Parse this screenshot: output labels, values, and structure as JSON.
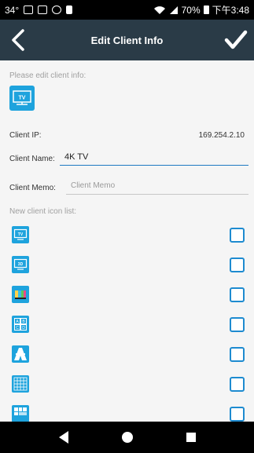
{
  "status_bar": {
    "temperature": "34°",
    "battery": "70%",
    "time": "下午3:48"
  },
  "app_bar": {
    "title": "Edit Client Info",
    "back_icon": "chevron-left-icon",
    "done_icon": "checkmark-icon"
  },
  "form": {
    "prompt": "Please edit client info:",
    "client_icon_text": "TV",
    "ip_label": "Client IP:",
    "ip_value": "169.254.2.10",
    "name_label": "Client Name:",
    "name_value": "4K TV",
    "memo_label": "Client Memo:",
    "memo_placeholder": "Client Memo",
    "list_heading": "New client icon list:"
  },
  "icon_list": [
    {
      "icon": "tv-icon",
      "label": "TV",
      "checked": false
    },
    {
      "icon": "3d-tv-icon",
      "label": "3D",
      "checked": false
    },
    {
      "icon": "color-bars-icon",
      "checked": false
    },
    {
      "icon": "abcd-grid-icon",
      "label": "A B C D",
      "checked": false
    },
    {
      "icon": "road-icon",
      "checked": false
    },
    {
      "icon": "numbers-grid-icon",
      "checked": false
    },
    {
      "icon": "multi-grid-icon",
      "checked": false
    }
  ],
  "colors": {
    "app_bar": "#2a3b47",
    "icon_blue": "#1ea3dd",
    "accent": "#1e7ac2"
  }
}
